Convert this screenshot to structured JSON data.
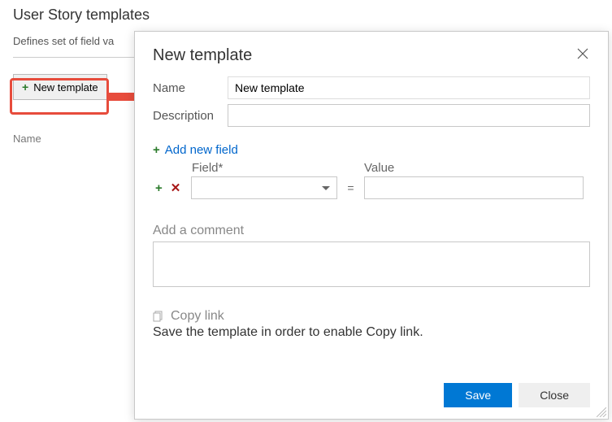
{
  "page": {
    "title": "User Story templates",
    "subtitle": "Defines set of field va",
    "new_template_btn": "New template",
    "list_header": "Name"
  },
  "modal": {
    "title": "New template",
    "labels": {
      "name": "Name",
      "description": "Description"
    },
    "values": {
      "name": "New template",
      "description": ""
    },
    "add_field_link": "Add new field",
    "field_header": {
      "field": "Field",
      "asterisk": "*",
      "value": "Value"
    },
    "field_row": {
      "equals": "=",
      "field_value": "",
      "value_value": ""
    },
    "comment": {
      "label": "Add a comment",
      "value": ""
    },
    "copy_link": {
      "label": "Copy link",
      "hint": "Save the template in order to enable Copy link."
    },
    "buttons": {
      "save": "Save",
      "close": "Close"
    }
  }
}
